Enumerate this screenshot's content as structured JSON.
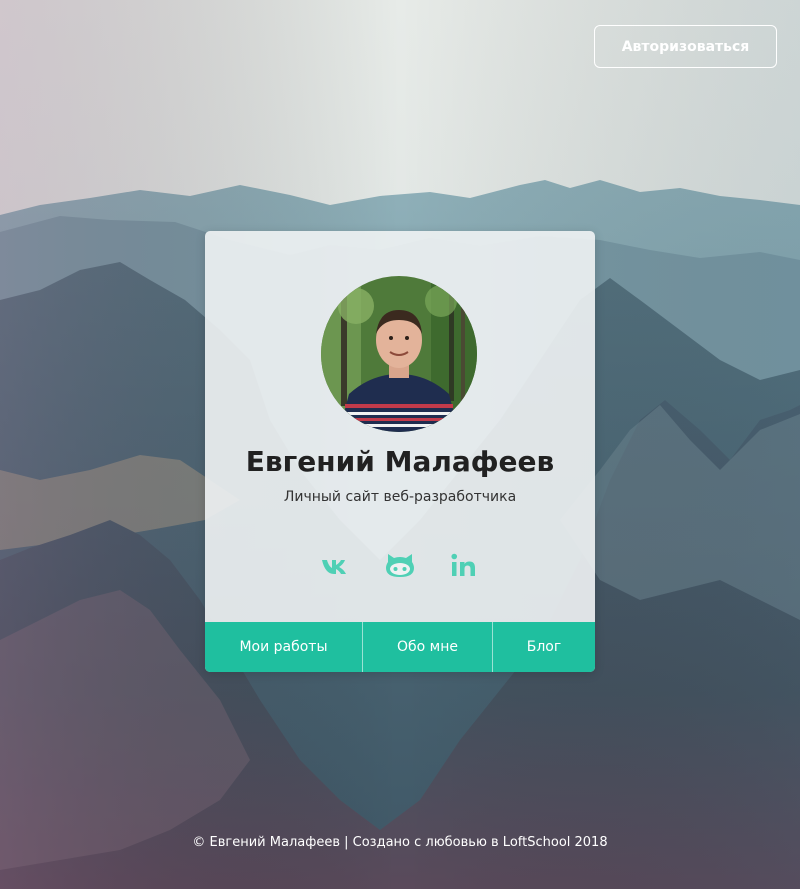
{
  "header": {
    "auth_label": "Авторизоваться"
  },
  "profile": {
    "name": "Евгений Малафеев",
    "subtitle": "Личный сайт веб-разработчика",
    "avatar_icon": "person-photo"
  },
  "socials": [
    {
      "icon": "vk-icon"
    },
    {
      "icon": "github-icon"
    },
    {
      "icon": "linkedin-icon"
    }
  ],
  "nav": {
    "items": [
      {
        "label": "Мои работы"
      },
      {
        "label": "Обо мне"
      },
      {
        "label": "Блог"
      }
    ]
  },
  "footer": {
    "text": "© Евгений Малафеев | Создано с любовью в LoftSchool 2018"
  },
  "colors": {
    "accent": "#1fbf9f",
    "social_icon": "#4fd0b5",
    "card_background": "#eef2f3"
  }
}
